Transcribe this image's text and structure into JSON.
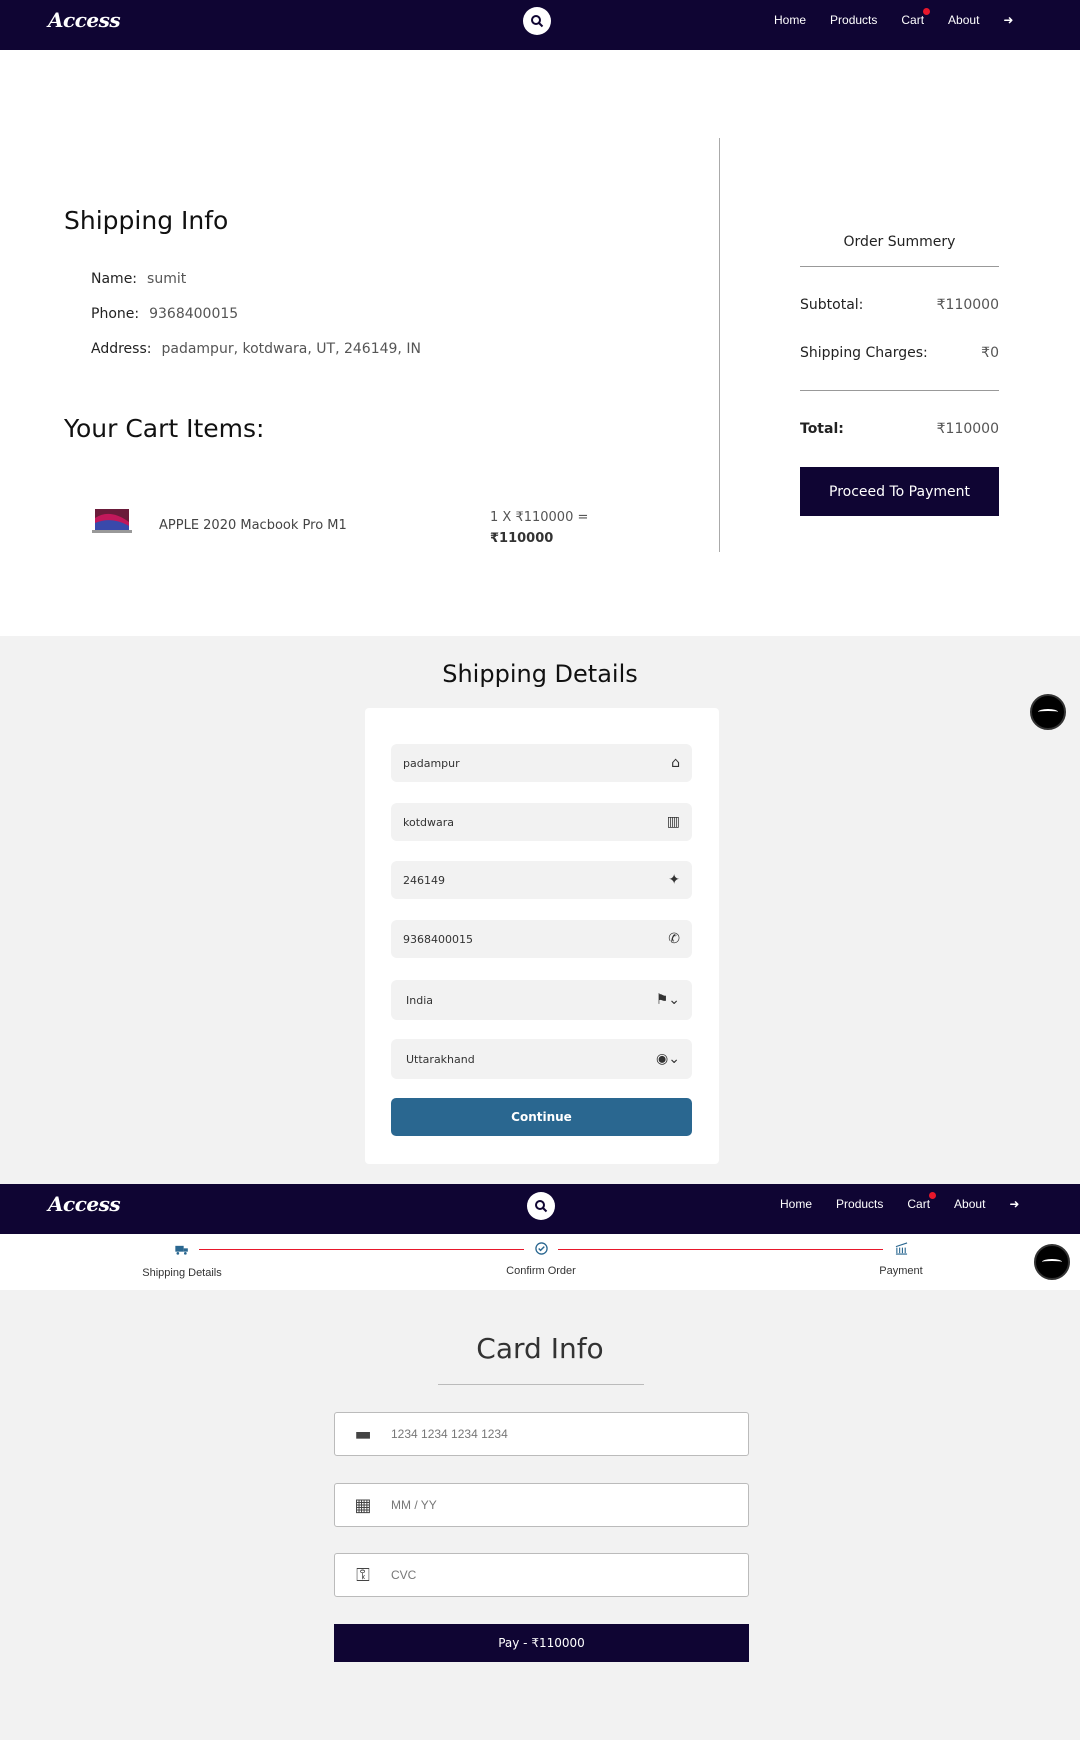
{
  "brand": "Access",
  "nav": {
    "home": "Home",
    "products": "Products",
    "cart": "Cart",
    "about": "About"
  },
  "steps": [
    "Shipping Details",
    "Confirm Order",
    "Payment"
  ],
  "confirm": {
    "shipping_title": "Shipping Info",
    "name_label": "Name:",
    "name_value": "sumit",
    "phone_label": "Phone:",
    "phone_value": "9368400015",
    "address_label": "Address:",
    "address_value": "padampur, kotdwara, UT, 246149, IN",
    "cart_title": "Your Cart Items:",
    "item_name": "APPLE 2020 Macbook Pro M1",
    "item_calc": "1 X ₹110000 =",
    "item_total": "₹110000",
    "summary_title": "Order Summery",
    "subtotal_label": "Subtotal:",
    "subtotal_value": "₹110000",
    "shipping_label": "Shipping Charges:",
    "shipping_value": "₹0",
    "total_label": "Total:",
    "total_value": "₹110000",
    "proceed_label": "Proceed To Payment"
  },
  "shipping_form": {
    "title": "Shipping Details",
    "address": "padampur",
    "city": "kotdwara",
    "pincode": "246149",
    "phone": "9368400015",
    "country": "India",
    "state": "Uttarakhand",
    "continue_label": "Continue"
  },
  "payment": {
    "title": "Card Info",
    "card_placeholder": "1234 1234 1234 1234",
    "expiry_placeholder": "MM / YY",
    "cvc_placeholder": "CVC",
    "pay_label": "Pay - ₹110000"
  },
  "colors": {
    "navy": "#0f0533",
    "accent_red": "#e8172b",
    "teal": "#2a6790"
  }
}
